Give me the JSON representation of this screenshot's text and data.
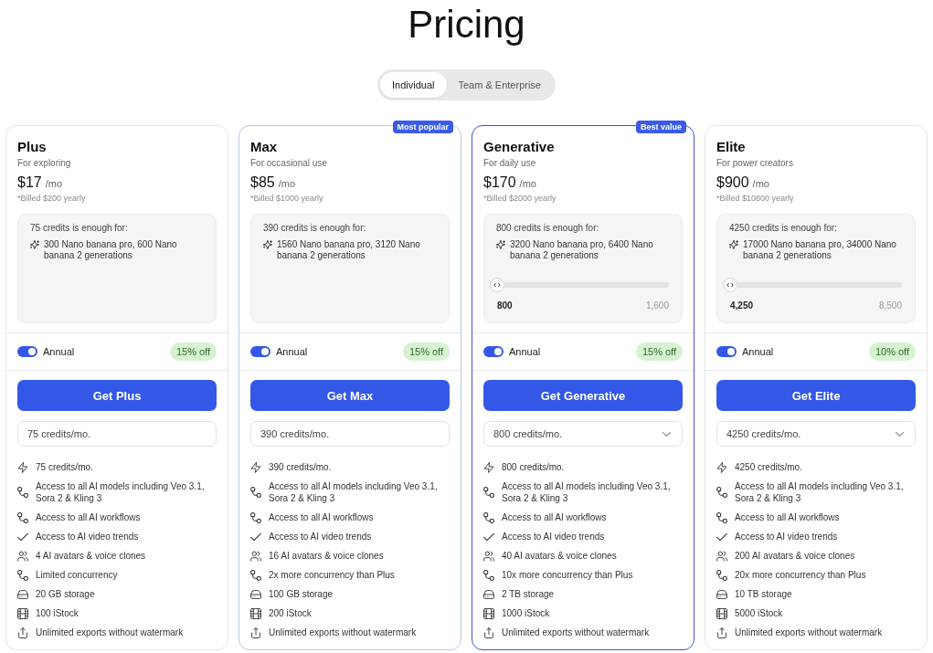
{
  "page": {
    "title": "Pricing"
  },
  "audience_tabs": [
    {
      "label": "Individual",
      "selected": true
    },
    {
      "label": "Team & Enterprise",
      "selected": false
    }
  ],
  "plans": [
    {
      "name": "Plus",
      "tagline": "For exploring",
      "price": "$17",
      "period": "/mo",
      "billing_note": "*Billed $200 yearly",
      "highlighted": false,
      "selected": false,
      "credits": {
        "summary": "75 credits is enough for:",
        "example": "300 Nano banana pro, 600 Nano banana 2 generations"
      },
      "annual": {
        "label": "Annual",
        "on": true
      },
      "discount": "15% off",
      "cta": "Get Plus",
      "credits_select": {
        "value": "75 credits/mo.",
        "dropdown": false
      },
      "features": [
        {
          "kind": "bolt",
          "text": "75 credits/mo."
        },
        {
          "kind": "nodes",
          "text": "Access to all AI models including Veo 3.1, Sora 2 & Kling 3"
        },
        {
          "kind": "nodes",
          "text": "Access to all AI workflows"
        },
        {
          "kind": "check",
          "text": "Access to AI video trends"
        },
        {
          "kind": "users",
          "text": "4 AI avatars & voice clones"
        },
        {
          "kind": "nodes",
          "text": "Limited concurrency"
        },
        {
          "kind": "drive",
          "text": "20 GB storage"
        },
        {
          "kind": "film",
          "text": "100 iStock"
        },
        {
          "kind": "export",
          "text": "Unlimited exports without watermark"
        }
      ]
    },
    {
      "name": "Max",
      "tagline": "For occasional use",
      "price": "$85",
      "period": "/mo",
      "billing_note": "*Billed $1000 yearly",
      "highlighted": true,
      "selected": false,
      "badge": "Most popular",
      "credits": {
        "summary": "390 credits is enough for:",
        "example": "1560 Nano banana pro, 3120 Nano banana 2 generations"
      },
      "annual": {
        "label": "Annual",
        "on": true
      },
      "discount": "15% off",
      "cta": "Get Max",
      "credits_select": {
        "value": "390 credits/mo.",
        "dropdown": false
      },
      "features": [
        {
          "kind": "bolt",
          "text": "390 credits/mo."
        },
        {
          "kind": "nodes",
          "text": "Access to all AI models including Veo 3.1, Sora 2 & Kling 3"
        },
        {
          "kind": "nodes",
          "text": "Access to all AI workflows"
        },
        {
          "kind": "check",
          "text": "Access to AI video trends"
        },
        {
          "kind": "users",
          "text": "16 AI avatars & voice clones"
        },
        {
          "kind": "nodes",
          "text": "2x more concurrency than Plus"
        },
        {
          "kind": "drive",
          "text": "100 GB storage"
        },
        {
          "kind": "film",
          "text": "200 iStock"
        },
        {
          "kind": "export",
          "text": "Unlimited exports without watermark"
        }
      ]
    },
    {
      "name": "Generative",
      "tagline": "For daily use",
      "price": "$170",
      "period": "/mo",
      "billing_note": "*Billed $2000 yearly",
      "highlighted": true,
      "selected": true,
      "badge": "Best value",
      "credits": {
        "summary": "800 credits is enough for:",
        "example": "3200 Nano banana pro, 6400 Nano banana 2 generations"
      },
      "slider": {
        "level": 0,
        "value": "800",
        "max": "1,600"
      },
      "annual": {
        "label": "Annual",
        "on": true
      },
      "discount": "15% off",
      "cta": "Get Generative",
      "credits_select": {
        "value": "800 credits/mo.",
        "dropdown": true
      },
      "features": [
        {
          "kind": "bolt",
          "text": "800 credits/mo."
        },
        {
          "kind": "nodes",
          "text": "Access to all AI models including Veo 3.1, Sora 2 & Kling 3"
        },
        {
          "kind": "nodes",
          "text": "Access to all AI workflows"
        },
        {
          "kind": "check",
          "text": "Access to AI video trends"
        },
        {
          "kind": "users",
          "text": "40 AI avatars & voice clones"
        },
        {
          "kind": "nodes",
          "text": "10x more concurrency than Plus"
        },
        {
          "kind": "drive",
          "text": "2 TB storage"
        },
        {
          "kind": "film",
          "text": "1000 iStock"
        },
        {
          "kind": "export",
          "text": "Unlimited exports without watermark"
        }
      ]
    },
    {
      "name": "Elite",
      "tagline": "For power creators",
      "price": "$900",
      "period": "/mo",
      "billing_note": "*Billed $10800 yearly",
      "highlighted": false,
      "selected": false,
      "credits": {
        "summary": "4250 credits is enough for:",
        "example": "17000 Nano banana pro, 34000 Nano banana 2 generations"
      },
      "slider": {
        "level": 0,
        "value": "4,250",
        "max": "8,500"
      },
      "annual": {
        "label": "Annual",
        "on": true
      },
      "discount": "10% off",
      "cta": "Get Elite",
      "credits_select": {
        "value": "4250 credits/mo.",
        "dropdown": true
      },
      "features": [
        {
          "kind": "bolt",
          "text": "4250 credits/mo."
        },
        {
          "kind": "nodes",
          "text": "Access to all AI models including Veo 3.1, Sora 2 & Kling 3"
        },
        {
          "kind": "nodes",
          "text": "Access to all AI workflows"
        },
        {
          "kind": "check",
          "text": "Access to AI video trends"
        },
        {
          "kind": "users",
          "text": "200 AI avatars & voice clones"
        },
        {
          "kind": "nodes",
          "text": "20x more concurrency than Plus"
        },
        {
          "kind": "drive",
          "text": "10 TB storage"
        },
        {
          "kind": "film",
          "text": "5000 iStock"
        },
        {
          "kind": "export",
          "text": "Unlimited exports without watermark"
        }
      ]
    }
  ]
}
